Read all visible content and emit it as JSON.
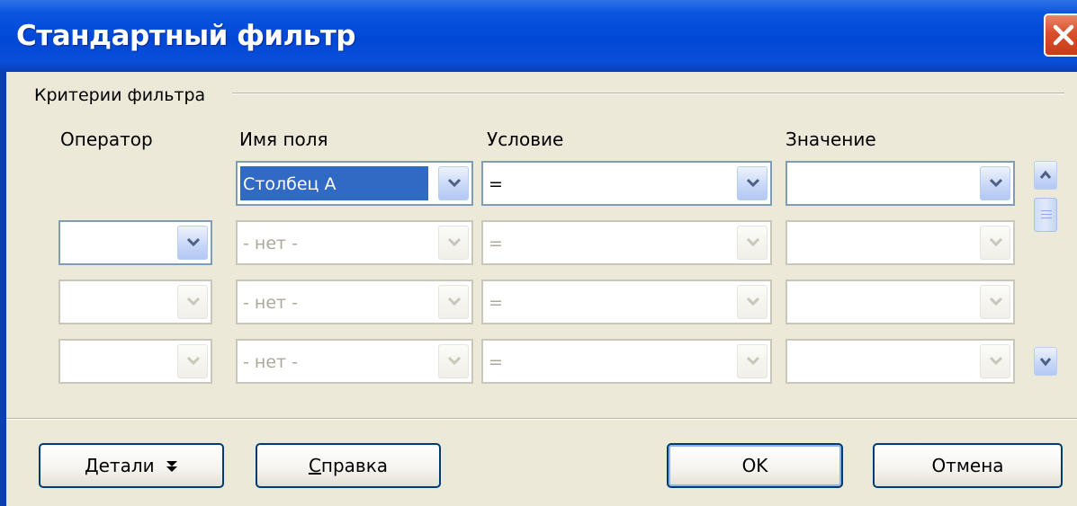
{
  "window": {
    "title": "Стандартный фильтр"
  },
  "group": {
    "label": "Критерии фильтра"
  },
  "columns": {
    "operator": "Оператор",
    "field": "Имя поля",
    "condition": "Условие",
    "value": "Значение"
  },
  "rows": [
    {
      "operator": "",
      "field": "Столбец A",
      "condition": "=",
      "value": ""
    },
    {
      "operator": "",
      "field": "- нет -",
      "condition": "=",
      "value": ""
    },
    {
      "operator": "",
      "field": "- нет -",
      "condition": "=",
      "value": ""
    },
    {
      "operator": "",
      "field": "- нет -",
      "condition": "=",
      "value": ""
    }
  ],
  "buttons": {
    "details": "Детали",
    "help_first": "С",
    "help_rest": "правка",
    "ok": "OK",
    "cancel": "Отмена"
  },
  "colors": {
    "titlebar": "#0a55e0",
    "dialog_bg": "#ece9d8",
    "selection": "#316ac5",
    "close_button": "#d9502a"
  }
}
